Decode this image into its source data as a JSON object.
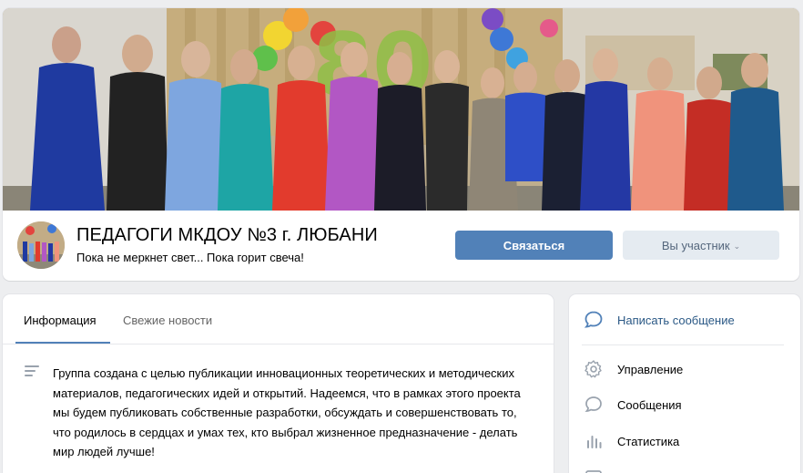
{
  "group": {
    "title": "ПЕДАГОГИ МКДОУ №3 г. ЛЮБАНИ",
    "status": "Пока не меркнет свет... Пока горит свеча!"
  },
  "actions": {
    "contact_label": "Связаться",
    "member_label": "Вы участник",
    "member_chevron": "⌄"
  },
  "tabs": [
    {
      "label": "Информация",
      "active": true
    },
    {
      "label": "Свежие новости",
      "active": false
    }
  ],
  "description": "Группа создана с целью публикации инновационных теоретических и методических материалов, педагогических идей и открытий. Надеемся, что в рамках этого проекта мы будем публиковать собственные разработки, обсуждать и совершенствовать то, что родилось в сердцах и умах тех, кто выбрал жизненное предназначение - делать мир людей лучше!",
  "sidebar": {
    "items": [
      {
        "label": "Написать сообщение",
        "icon": "message-bubble-icon"
      },
      {
        "label": "Управление",
        "icon": "gear-icon"
      },
      {
        "label": "Сообщения",
        "icon": "chat-icon"
      },
      {
        "label": "Статистика",
        "icon": "stats-bars-icon"
      }
    ]
  },
  "colors": {
    "accent": "#5181b8",
    "link": "#2a5885",
    "secondary_button": "#e5ebf1",
    "page_bg": "#edeef0"
  }
}
